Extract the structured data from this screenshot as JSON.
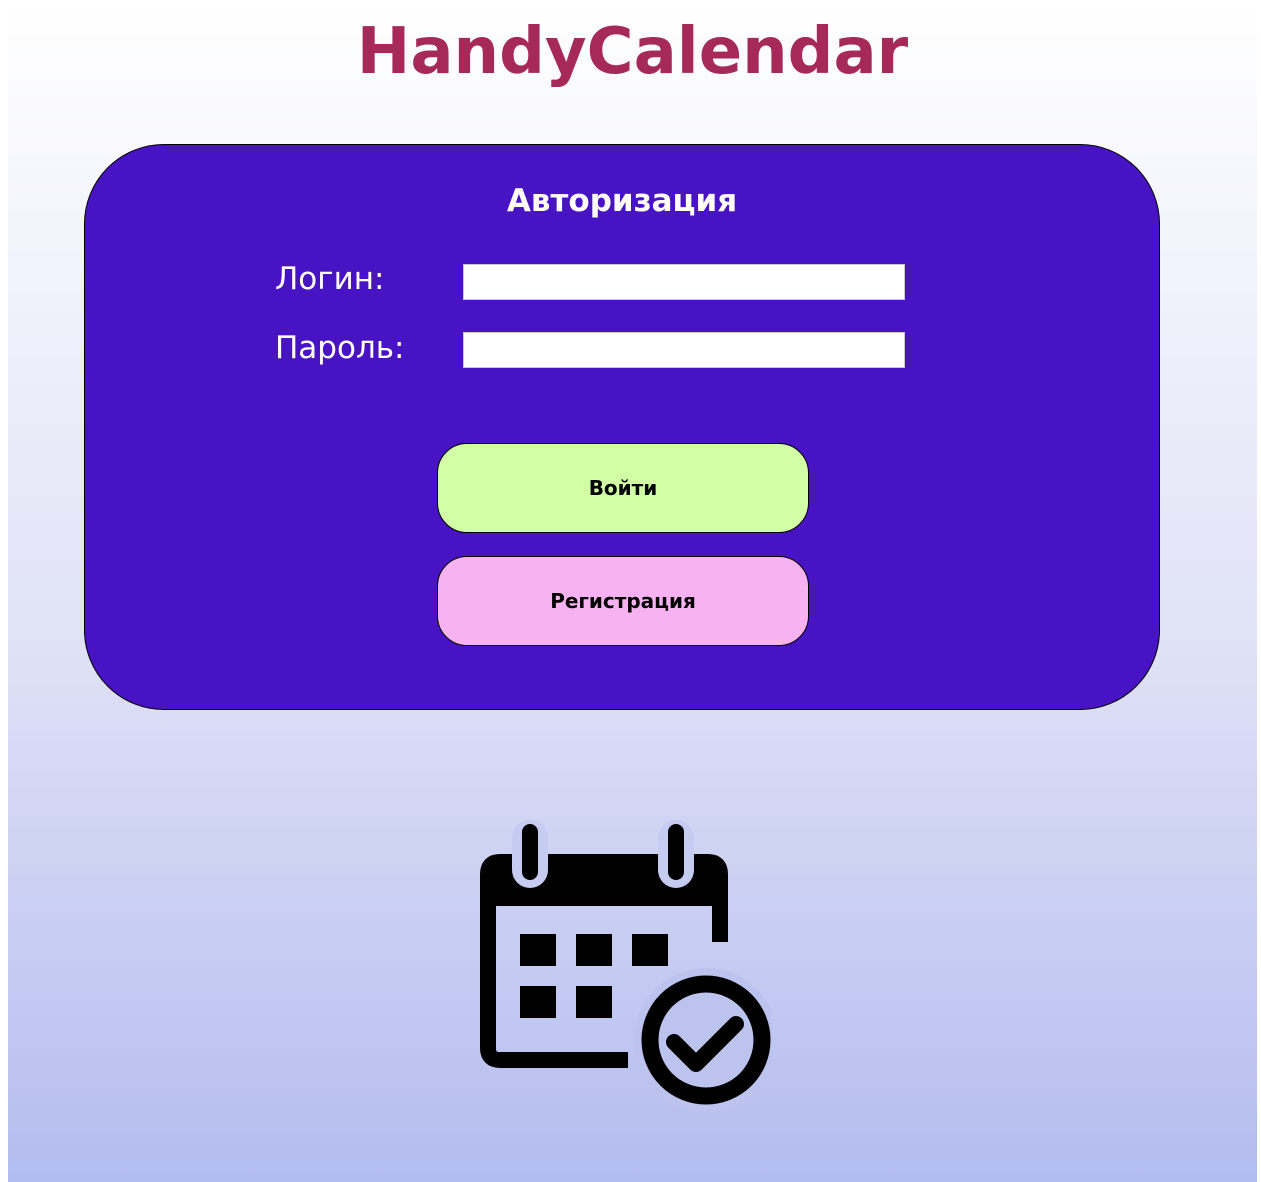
{
  "app": {
    "title": "HandyCalendar"
  },
  "login_form": {
    "heading": "Авторизация",
    "login_label": "Логин:",
    "login_value": "",
    "password_label": "Пароль:",
    "password_value": "",
    "submit_label": "Войти",
    "register_label": "Регистрация"
  },
  "illustration": {
    "icon": "calendar-check-icon"
  },
  "colors": {
    "title": "#a52a5a",
    "panel": "#4813c2",
    "login_button": "#d2ffa6",
    "register_button": "#f8b2f2",
    "background_top": "#ffffff",
    "background_bottom": "#b3bcef"
  }
}
